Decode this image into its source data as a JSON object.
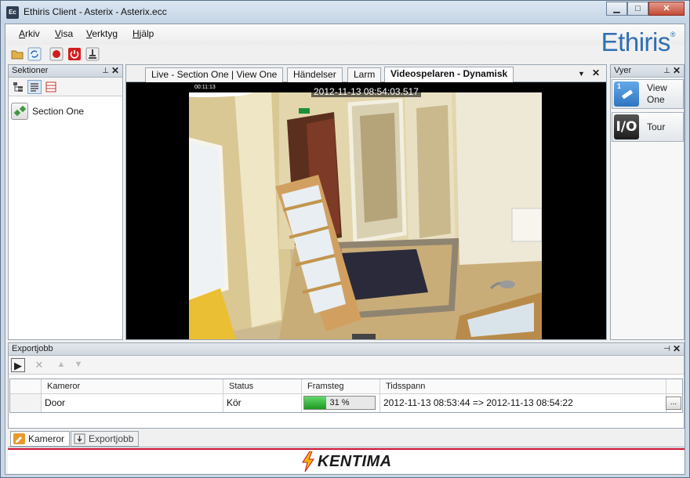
{
  "window": {
    "title": "Ethiris Client - Asterix - Asterix.ecc",
    "app_icon": "Ec",
    "minimize_glyph": "▁",
    "maximize_glyph": "□",
    "close_glyph": "✕"
  },
  "menu": {
    "items": [
      "Arkiv",
      "Visa",
      "Verktyg",
      "Hjälp"
    ]
  },
  "brand": {
    "logo": "Ethiris",
    "reg_mark": "®"
  },
  "toolbar": {
    "icons": [
      "folder-icon",
      "sync-icon",
      "record-icon",
      "power-icon",
      "stamp-icon"
    ]
  },
  "sektioner": {
    "title": "Sektioner",
    "pin_glyph": "⊥",
    "close_glyph": "✕",
    "items": [
      {
        "label": "Section One"
      }
    ]
  },
  "tabs": {
    "items": [
      {
        "label": "Live - Section One | View One",
        "active": false
      },
      {
        "label": "Händelser",
        "active": false
      },
      {
        "label": "Larm",
        "active": false
      },
      {
        "label": "Videospelaren - Dynamisk",
        "active": true
      }
    ],
    "dropdown_glyph": "▼",
    "close_glyph": "✕"
  },
  "video": {
    "timestamp": "2012-11-13 08:54:03.517",
    "mini_timestamp": "00:11:13"
  },
  "vyer": {
    "title": "Vyer",
    "pin_glyph": "⊥",
    "close_glyph": "✕",
    "views": [
      {
        "label": "View One",
        "icon": "view-one-icon",
        "icon_text": "1"
      },
      {
        "label": "Tour",
        "icon": "tour-icon",
        "icon_text": "I/O"
      }
    ]
  },
  "export": {
    "title": "Exportjobb",
    "pin_glyph": "⊣",
    "close_glyph": "✕",
    "toolbar_glyphs": {
      "play": "▶",
      "cancel": "✕",
      "up": "▲",
      "down": "▼"
    },
    "columns": [
      "Kameror",
      "Status",
      "Framsteg",
      "Tidsspann"
    ],
    "rows": [
      {
        "camera": "Door",
        "status": "Kör",
        "progress_label": "31 %",
        "progress": 0.31,
        "timespan": "2012-11-13 08:53:44 => 2012-11-13 08:54:22"
      }
    ],
    "more_button": "..."
  },
  "bottom_tabs": [
    {
      "label": "Kameror",
      "active": true
    },
    {
      "label": "Exportjobb",
      "active": false
    }
  ],
  "footer": {
    "brand": "KENTIMA"
  },
  "colors": {
    "accent_blue": "#2e6fb3",
    "progress_green": "#1d9a23",
    "kentima_red": "#c8102e",
    "kentima_yellow": "#f2b705"
  }
}
